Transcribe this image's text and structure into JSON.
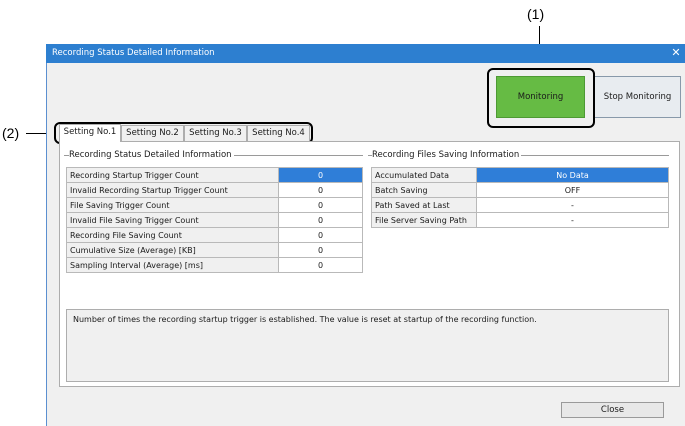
{
  "callouts": {
    "one": "(1)",
    "two": "(2)"
  },
  "window": {
    "title": "Recording Status Detailed Information",
    "close_glyph": "✕"
  },
  "buttons": {
    "monitoring": "Monitoring",
    "stop_monitoring": "Stop Monitoring",
    "close": "Close"
  },
  "tabs": [
    "Setting No.1",
    "Setting No.2",
    "Setting No.3",
    "Setting No.4"
  ],
  "status_group": {
    "title": "Recording Status Detailed Information",
    "rows": [
      {
        "label": "Recording Startup Trigger Count",
        "value": "0"
      },
      {
        "label": "Invalid Recording Startup Trigger Count",
        "value": "0"
      },
      {
        "label": "File Saving Trigger Count",
        "value": "0"
      },
      {
        "label": "Invalid File Saving Trigger Count",
        "value": "0"
      },
      {
        "label": "Recording File Saving Count",
        "value": "0"
      },
      {
        "label": "Cumulative Size (Average) [KB]",
        "value": "0"
      },
      {
        "label": "Sampling Interval (Average) [ms]",
        "value": "0"
      }
    ]
  },
  "files_group": {
    "title": "Recording Files Saving Information",
    "rows": [
      {
        "label": "Accumulated Data",
        "value": "No Data"
      },
      {
        "label": "Batch Saving",
        "value": "OFF"
      },
      {
        "label": "Path Saved at Last",
        "value": "-"
      },
      {
        "label": "File Server Saving Path",
        "value": "-"
      }
    ]
  },
  "description": "Number of times the recording startup trigger is established. The value is reset at startup of the recording function.",
  "colors": {
    "titlebar": "#2d7fd0",
    "monitoring": "#66bb44",
    "selection": "#2f7ed8"
  }
}
